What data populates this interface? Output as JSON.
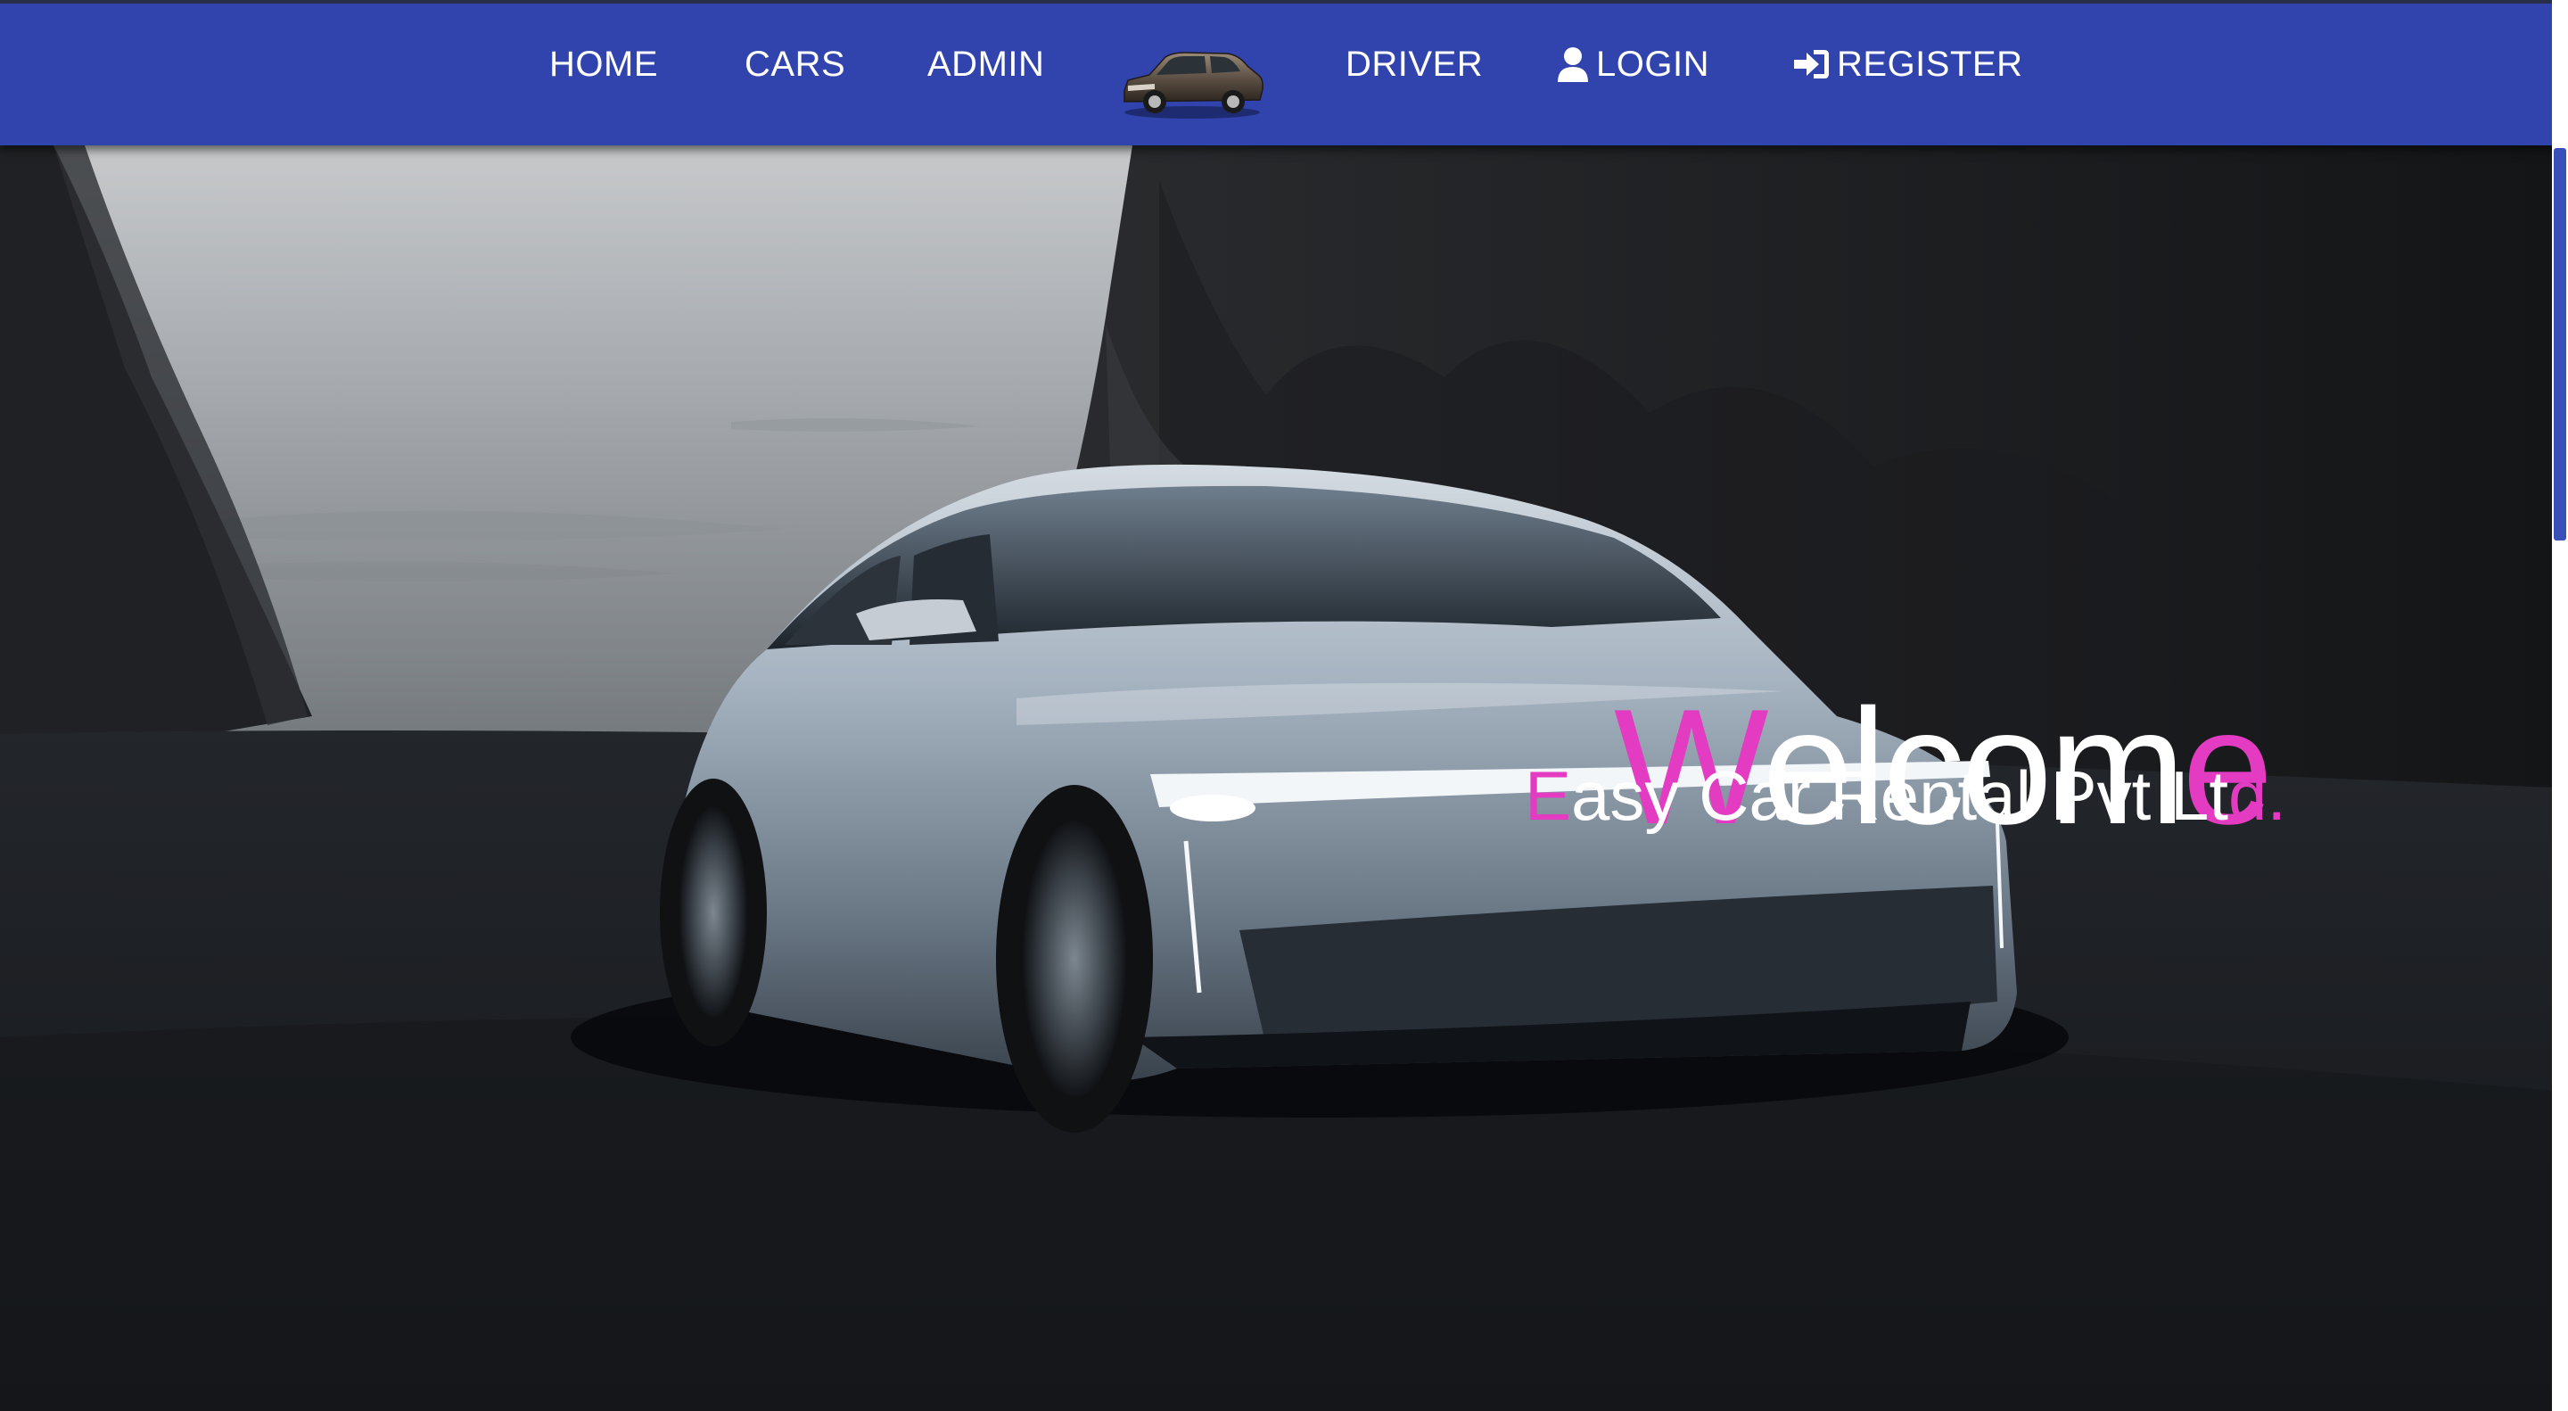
{
  "nav": {
    "home": "HOME",
    "cars": "CARS",
    "admin": "ADMIN",
    "driver": "DRIVER",
    "login": "LOGIN",
    "register": "REGISTER"
  },
  "hero": {
    "welcome": {
      "first": "W",
      "middle": "elcom",
      "last": "e"
    },
    "tagline": {
      "first": "E",
      "middle": "asy Car Rental Pvt Lt",
      "last": "d."
    }
  },
  "icons": {
    "login": "user-icon",
    "register": "sign-in-icon",
    "logo": "car-logo-icon"
  },
  "colors": {
    "navbar": "#3143ad",
    "accent": "#e33bc1",
    "text": "#ffffff"
  }
}
